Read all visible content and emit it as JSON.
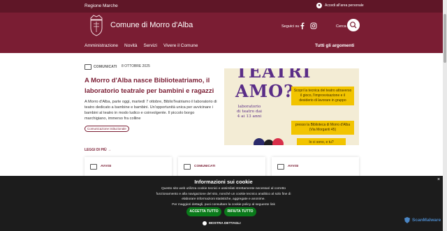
{
  "topbar": {
    "region": "Regione Marche",
    "login_label": "Accedi all'area personale"
  },
  "header": {
    "site_title": "Comune di Morro d'Alba",
    "social_label": "Seguici su",
    "search_label": "Cerca"
  },
  "nav": {
    "items": [
      "Amministrazione",
      "Novità",
      "Servizi",
      "Vivere il Comune"
    ],
    "all_topics": "Tutti gli argomenti"
  },
  "article": {
    "category": "COMUNICATI",
    "date": "8 OTTOBRE 2025",
    "title": "A Morro d'Alba nasce Biblioteatriamo, il laboratorio teatrale per bambini e ragazzi",
    "text": "A Morro d'Alba, parte oggi, martedì 7 ottobre, BiblioTeatriamo il laboratorio di teatro dedicato a bambine e bambini. Un'opportunità unica per avvicinare i bambini al teatro in modo ludico e coinvolgente. Il piccolo borgo marchigiano, immerso fra colline",
    "tag": "Comunicazione istituzionale",
    "read_more": "LEGGI DI PIÙ"
  },
  "poster": {
    "line1": "TEATRI",
    "line2": "AMO?",
    "sub": "laboratorio di teatro dai 4 ai 13 anni",
    "note1": "Scopri la tecnica del teatro attraverso il gioco, l'improvvisazione e il desiderio di lavorare in gruppo",
    "note2": "presso la Biblioteca di Morro d'Alba (Via Morganti 45)",
    "note3": "Io ci sono, e tu?"
  },
  "cards": [
    {
      "label": "AVVISI"
    },
    {
      "label": "COMUNICATI"
    },
    {
      "label": "AVVISI"
    }
  ],
  "cookie": {
    "close": "×",
    "title": "Informazioni sui cookie",
    "text1": "Questo sito web utilizza cookie tecnici e assimilati strettamente necessari al corretto funzionamento e alla navigazione del sito, nonché un cookie tecnico analitico al solo fine di elaborare informazioni statistiche, aggregate e anonime.",
    "text2": "Per maggiori dettagli, puoi consultare la cookie policy al seguente link",
    "accept": "ACCETTA TUTTO",
    "reject": "RIFIUTA TUTTO",
    "details": "MOSTRA DETTAGLI"
  },
  "watermark": "ScanMalware",
  "colors": {
    "brand": "#7a1d33",
    "topbar": "#5f1627",
    "cookie_bg": "#1c1c1c",
    "button_green": "#0a7a1a",
    "poster_purple": "#5a2d87",
    "poster_yellow": "#f2c400"
  }
}
